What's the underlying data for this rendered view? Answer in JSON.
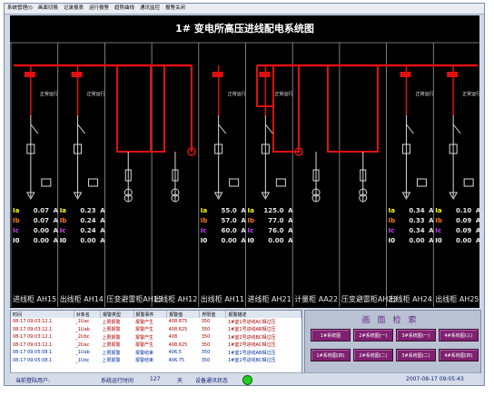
{
  "menu": [
    "系统管理(I)",
    "画面切换",
    "记录报表",
    "运行报警",
    "趋势曲线",
    "通讯监控",
    "报警关闭"
  ],
  "title": "1# 变电所高压进线配电系统图",
  "cabinets": [
    "进线柜 AH15",
    "出线柜 AH14",
    "压变避雷柜AH13",
    "出线柜 AH12",
    "出线柜 AH11",
    "进线柜 AH21",
    "计量柜 AA22",
    "压变避雷柜AH23",
    "出线柜 AH24",
    "出线柜 AH25"
  ],
  "status_label": "正常运行",
  "meas_names": [
    "Ia",
    "Ib",
    "Ic",
    "I0"
  ],
  "meas_unit": "A",
  "measurements": [
    {
      "cabinet": "进线柜 AH15",
      "values": [
        "0.07",
        "0.07",
        "0.00",
        "0.00"
      ]
    },
    {
      "cabinet": "出线柜 AH14",
      "values": [
        "0.23",
        "0.24",
        "0.24",
        "0.00"
      ]
    },
    {
      "cabinet": "出线柜 AH11",
      "values": [
        "55.0",
        "57.0",
        "60.0",
        "0.00"
      ]
    },
    {
      "cabinet": "进线柜 AH21",
      "values": [
        "125.0",
        "77.0",
        "76.0",
        "0.00"
      ]
    },
    {
      "cabinet": "出线柜 AH24",
      "values": [
        "0.34",
        "0.33",
        "0.34",
        "0.00"
      ]
    },
    {
      "cabinet": "出线柜 AH25",
      "values": [
        "0.10",
        "0.09",
        "0.09",
        "0.00"
      ]
    }
  ],
  "alarm_table": {
    "headers": [
      "时间",
      "对象名",
      "报警类型",
      "报警事件",
      "报警值",
      "界限值",
      "报警描述"
    ],
    "rows": [
      [
        "08-17 09:03:12.1",
        "_1Uac",
        "上限报警",
        "报警产生",
        "408.875",
        "350",
        "1#室1号进线AC相过压"
      ],
      [
        "08-17 09:03:12.1",
        "_1Uab",
        "上限报警",
        "报警产生",
        "408.625",
        "350",
        "1#室1号进线AB相过压"
      ],
      [
        "08-17 09:03:12.1",
        "_2Ubc",
        "上限报警",
        "报警产生",
        "408",
        "350",
        "1#室2号进线BC相过压"
      ],
      [
        "08-17 09:03:12.1",
        "_2Uac",
        "上限报警",
        "报警产生",
        "408.625",
        "350",
        "1#室2号进线AC相过压"
      ],
      [
        "08-17 09:05:08.1",
        "_1Uab",
        "上限报警",
        "报警结束",
        "406.5",
        "350",
        "1#室1号进线AB相过压"
      ],
      [
        "08-17 09:05:08.1",
        "_1Ubc",
        "上限报警",
        "报警结束",
        "406.75",
        "350",
        "1#室1号进线BC相过压"
      ]
    ]
  },
  "nav": {
    "title": "画面检索",
    "buttons": [
      "1#系统图",
      "2#系统图(一)",
      "3#系统图(一)",
      "4#系统图(三)",
      "1#系统图(四)",
      "2#系统图(二)",
      "3#系统图(二)",
      "4#系统图(四)"
    ]
  },
  "status": {
    "user_label": "当前登陆用户:",
    "runtime_label": "系统运行时间",
    "runtime_value": "127",
    "runtime_unit": "天",
    "comm_label": "设备通讯状态",
    "datetime": "2007-08-17    09:05:43"
  },
  "colors": {
    "busbar": "#e01010",
    "wire": "#d8d8d8",
    "ia": "#ffff00",
    "ib": "#ff7a1a",
    "ic": "#d040ff",
    "i0": "#ffffff",
    "status_light": "#20d020"
  }
}
